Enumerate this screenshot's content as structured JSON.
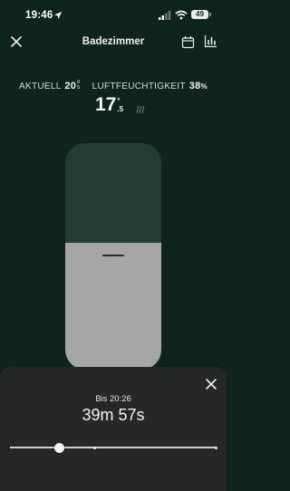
{
  "status_bar": {
    "time": "19:46",
    "battery": "49"
  },
  "header": {
    "title": "Badezimmer"
  },
  "metrics": {
    "current_label": "AKTUELL",
    "current_value": "20",
    "current_frac_top": "0",
    "current_frac_bottom": "5",
    "humidity_label": "LUFTFEUCHTIGKEIT",
    "humidity_value": "38",
    "humidity_unit": "%"
  },
  "setpoint": {
    "main": "17",
    "unit": "°",
    "frac": ".5"
  },
  "temperature_slider": {
    "level": 0.56
  },
  "timer_sheet": {
    "until": "Bis 20:26",
    "remaining": "39m 57s",
    "slider_value": 0.24,
    "ticks": [
      0.41,
      1.0
    ]
  },
  "colors": {
    "background": "#0f251b",
    "slider_track": "#243b31",
    "slider_fill": "#a5a7a6",
    "sheet": "#262727"
  },
  "icons": {
    "close": "close-icon",
    "calendar": "calendar-icon",
    "chart": "bar-chart-icon",
    "heating": "heat-waves-icon",
    "location": "location-arrow-icon"
  }
}
